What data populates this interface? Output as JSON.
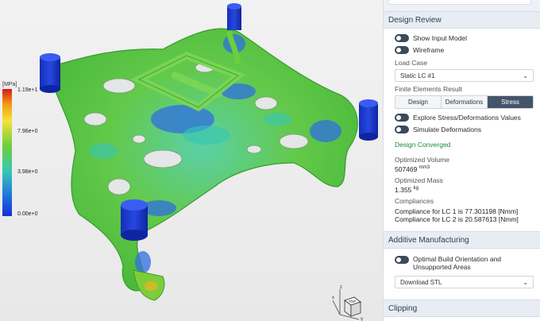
{
  "legend": {
    "unit": "[MPa]",
    "ticks": [
      "1.19e+1",
      "7.96e+0",
      "3.98e+0",
      "0.00e+0"
    ]
  },
  "panel": {
    "design_review": {
      "title": "Design Review",
      "toggle_input_model": "Show Input Model",
      "toggle_wireframe": "Wireframe",
      "load_case_label": "Load Case",
      "load_case_value": "Static LC #1",
      "fe_result_label": "Finite Elements Result",
      "fe_tabs": [
        "Design",
        "Deformations",
        "Stress"
      ],
      "fe_selected": "Stress",
      "toggle_explore": "Explore Stress/Deformations Values",
      "toggle_simulate": "Simulate Deformations",
      "status": "Design Converged",
      "optimized_volume_label": "Optimized Volume",
      "optimized_volume_value": "507469",
      "optimized_volume_unit": "mm3",
      "optimized_mass_label": "Optimized Mass",
      "optimized_mass_value": "1.355",
      "optimized_mass_unit": "kg",
      "compliances_label": "Compliances",
      "compliance_lines": [
        "Compliance for LC 1 is 77.301198 [Nmm]",
        "Compliance for LC 2 is 20.587613 [Nmm]"
      ]
    },
    "additive": {
      "title": "Additive Manufacturing",
      "toggle_build": "Optimal Build Orientation and Unsupported Areas",
      "download_value": "Download STL"
    },
    "clipping": {
      "title": "Clipping"
    }
  },
  "gizmo": {
    "face_label": "TOP",
    "axis_x": "x",
    "axis_y": "y",
    "axis_z": "z"
  },
  "colors": {
    "accent_dark": "#44546a",
    "converged_green": "#1a8b3b",
    "stress_low": "#1a2ed6",
    "stress_mid": "#6ccf3c",
    "stress_high": "#d7191c"
  }
}
